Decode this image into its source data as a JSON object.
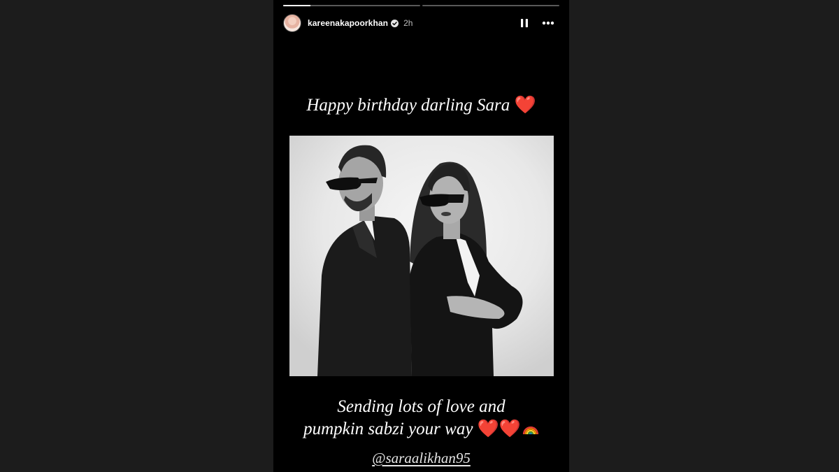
{
  "story": {
    "progress": [
      0.2,
      0.0
    ],
    "username": "kareenakapoorkhan",
    "timestamp": "2h",
    "verified_icon": "verified-badge-icon",
    "pause_icon": "pause-icon",
    "more_icon": "more-options-icon"
  },
  "captions": {
    "top_text": "Happy birthday darling Sara",
    "top_emoji": "❤️",
    "bottom_line1": "Sending lots of love and",
    "bottom_line2": "pumpkin sabzi your way",
    "bottom_emoji": "❤️❤️",
    "mention": "@saraalikhan95"
  },
  "photo": {
    "style": "black-and-white",
    "subjects": [
      "man in suit and sunglasses",
      "woman in suit and sunglasses"
    ]
  },
  "colors": {
    "background": "#000000",
    "page": "#1c1c1c",
    "heart": "#e01f2b"
  }
}
